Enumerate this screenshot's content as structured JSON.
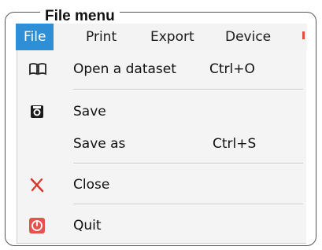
{
  "frame": {
    "title": "File menu"
  },
  "menubar": {
    "items": [
      {
        "label": "File"
      },
      {
        "label": "Print"
      },
      {
        "label": "Export"
      },
      {
        "label": "Device"
      }
    ]
  },
  "menu": {
    "items": [
      {
        "label": "Open a dataset",
        "shortcut": "Ctrl+O",
        "icon": "book-open-icon"
      },
      {
        "label": "Save",
        "shortcut": "",
        "icon": "save-disk-icon"
      },
      {
        "label": "Save as",
        "shortcut": "Ctrl+S",
        "icon": ""
      },
      {
        "label": "Close",
        "shortcut": "",
        "icon": "close-x-icon"
      },
      {
        "label": "Quit",
        "shortcut": "",
        "icon": "power-quit-icon"
      }
    ]
  },
  "colors": {
    "active_menu_bg": "#2f8fd6",
    "close_icon": "#d23a2a",
    "quit_icon": "#e4534f"
  }
}
